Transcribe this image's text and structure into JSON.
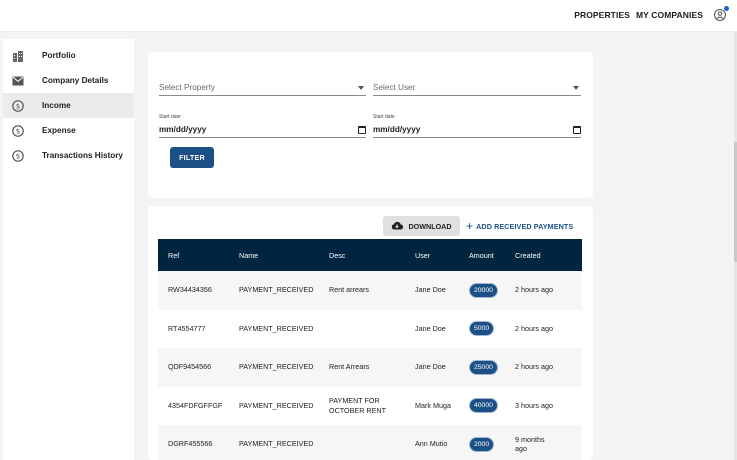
{
  "topnav": {
    "properties": "PROPERTIES",
    "my_companies": "MY COMPANIES",
    "account_icon": "account-circle-icon",
    "notification_color": "#1f5fc6"
  },
  "sidebar": {
    "items": [
      {
        "label": "Portfolio",
        "icon": "building-icon",
        "active": false
      },
      {
        "label": "Company Details",
        "icon": "envelope-icon",
        "active": false
      },
      {
        "label": "Income",
        "icon": "dollar-circle-icon",
        "active": true
      },
      {
        "label": "Expense",
        "icon": "dollar-circle-icon",
        "active": false
      },
      {
        "label": "Transactions History",
        "icon": "dollar-circle-icon",
        "active": false
      }
    ]
  },
  "filters": {
    "property_placeholder": "Select Property",
    "user_placeholder": "Select User",
    "start_date_label_1": "Start date",
    "start_date_label_2": "Start date",
    "date_1": "mm/dd/yyyy",
    "date_2": "mm/dd/yyyy",
    "filter_button": "FILTER"
  },
  "actions": {
    "download": "DOWNLOAD",
    "add_received": "ADD RECEIVED PAYMENTS"
  },
  "table": {
    "headers": [
      "Ref",
      "Name",
      "Desc",
      "User",
      "Amount",
      "Created"
    ],
    "rows": [
      {
        "ref": "RW34434356",
        "name": "PAYMENT_RECEIVED",
        "desc": "Rent arrears",
        "user": "Jane Doe",
        "amount": "20000",
        "created": "2 hours ago"
      },
      {
        "ref": "RT4554777",
        "name": "PAYMENT_RECEIVED",
        "desc": "",
        "user": "Jane Doe",
        "amount": "5000",
        "created": "2 hours ago"
      },
      {
        "ref": "QDF9454566",
        "name": "PAYMENT_RECEIVED",
        "desc": "Rent Arrears",
        "user": "Jane Doe",
        "amount": "25000",
        "created": "2 hours ago"
      },
      {
        "ref": "4354FDFGFFGF",
        "name": "PAYMENT_RECEIVED",
        "desc": "PAYMENT FOR OCTOBER RENT",
        "user": "Mark Muga",
        "amount": "40000",
        "created": "3 hours ago"
      },
      {
        "ref": "DGRF455566",
        "name": "PAYMENT_RECEIVED",
        "desc": "",
        "user": "Ann Mutio",
        "amount": "2000",
        "created": "9 months ago"
      }
    ]
  },
  "colors": {
    "primary": "#1c4f86",
    "table_header": "#002540",
    "background": "#f4f4f4"
  }
}
